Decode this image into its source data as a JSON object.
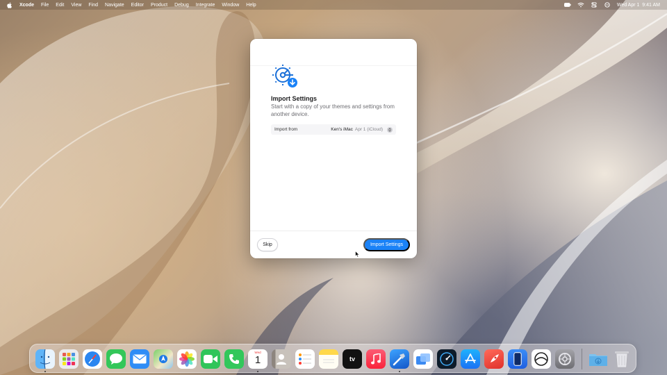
{
  "menubar": {
    "app_name": "Xcode",
    "items": [
      "File",
      "Edit",
      "View",
      "Find",
      "Navigate",
      "Editor",
      "Product",
      "Debug",
      "Integrate",
      "Window",
      "Help"
    ],
    "clock": "Wed Apr 1  9:41 AM",
    "status_icons": [
      "battery-icon",
      "wifi-icon",
      "control-center-icon",
      "siri-icon"
    ]
  },
  "dialog": {
    "title": "Import Settings",
    "description": "Start with a copy of your themes and settings from another device.",
    "import_from_label": "Import from",
    "import_from_value": "Ken's iMac",
    "import_from_detail": "Apr 1 (iCloud)",
    "skip_label": "Skip",
    "import_label": "Import Settings",
    "icon": "settings-import-icon",
    "accent": "#1a82f7"
  },
  "dock": {
    "apps": [
      {
        "name": "finder",
        "color": "#3e9ef5"
      },
      {
        "name": "launchpad",
        "color": "#e8e8ea"
      },
      {
        "name": "safari",
        "color": "#2b86f0"
      },
      {
        "name": "messages",
        "color": "#33c759"
      },
      {
        "name": "mail",
        "color": "#2f8df6"
      },
      {
        "name": "maps",
        "color": "#59c36a"
      },
      {
        "name": "photos",
        "color": "#ffffff"
      },
      {
        "name": "facetime",
        "color": "#2fc55a"
      },
      {
        "name": "phone",
        "color": "#32c75b"
      },
      {
        "name": "calendar",
        "color": "#ffffff"
      },
      {
        "name": "contacts",
        "color": "#a8a29c"
      },
      {
        "name": "reminders",
        "color": "#ffffff"
      },
      {
        "name": "notes",
        "color": "#ffd84a"
      },
      {
        "name": "tv",
        "color": "#111111"
      },
      {
        "name": "music",
        "color": "#fa3d55"
      },
      {
        "name": "xcode",
        "color": "#1f7ae6"
      },
      {
        "name": "preview",
        "color": "#3b8af2"
      },
      {
        "name": "instruments",
        "color": "#0d1b2a"
      },
      {
        "name": "app-store",
        "color": "#1c8cf7"
      },
      {
        "name": "rocketsim",
        "color": "#f0453a"
      },
      {
        "name": "simulator",
        "color": "#1e6ff0"
      },
      {
        "name": "accessibility-inspector",
        "color": "#ffffff"
      },
      {
        "name": "system-settings",
        "color": "#8e8e93"
      },
      {
        "name": "downloads-folder",
        "color": "#6cb7ea"
      },
      {
        "name": "trash",
        "color": "#c7c7cc"
      }
    ],
    "calendar_month": "Wed",
    "calendar_day": "1",
    "tv_label": "tv"
  }
}
